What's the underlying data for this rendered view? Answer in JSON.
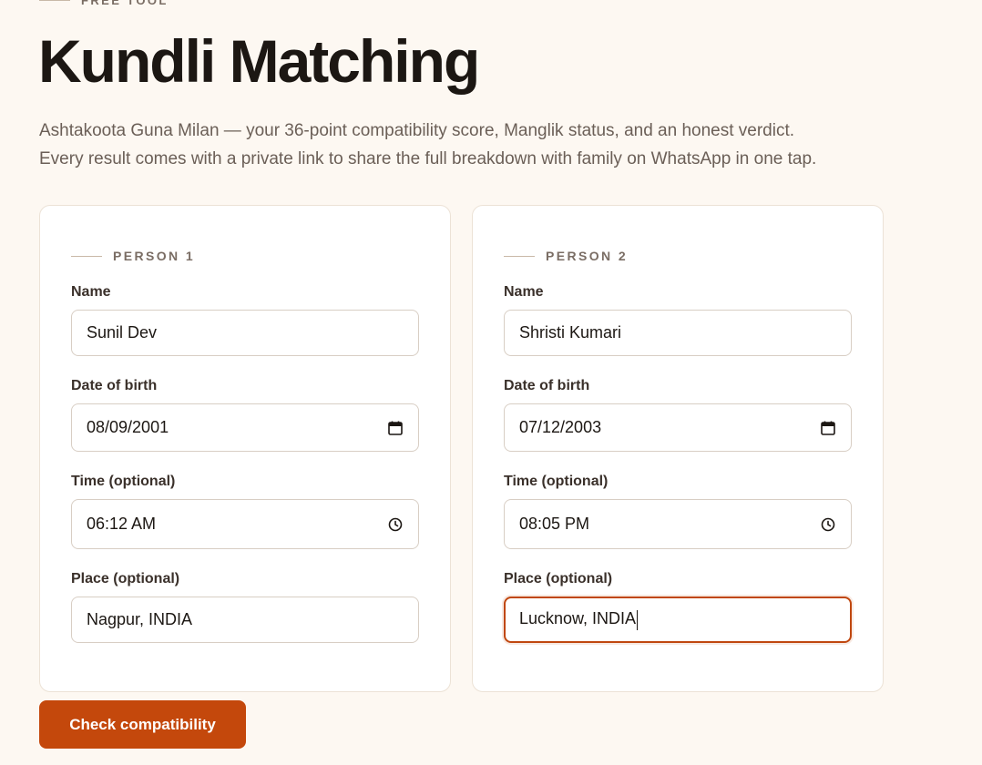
{
  "header": {
    "eyebrow": "FREE TOOL",
    "title": "Kundli Matching",
    "subtitle_line1": "Ashtakoota Guna Milan — your 36-point compatibility score, Manglik status, and an honest verdict.",
    "subtitle_line2": "Every result comes with a private link to share the full breakdown with family on WhatsApp in one tap."
  },
  "person1": {
    "heading": "PERSON 1",
    "name_label": "Name",
    "name_value": "Sunil Dev",
    "dob_label": "Date of birth",
    "dob_value": "08/09/2001",
    "time_label": "Time (optional)",
    "time_value": "06:12 AM",
    "place_label": "Place (optional)",
    "place_value": "Nagpur, INDIA"
  },
  "person2": {
    "heading": "PERSON 2",
    "name_label": "Name",
    "name_value": "Shristi Kumari",
    "dob_label": "Date of birth",
    "dob_value": "07/12/2003",
    "time_label": "Time (optional)",
    "time_value": "08:05 PM",
    "place_label": "Place (optional)",
    "place_value": "Lucknow, INDIA"
  },
  "actions": {
    "submit_label": "Check compatibility"
  },
  "icons": {
    "date": "calendar-icon",
    "time": "clock-icon"
  },
  "colors": {
    "accent": "#c4480c",
    "background": "#fdf8f2",
    "card": "#ffffff"
  }
}
